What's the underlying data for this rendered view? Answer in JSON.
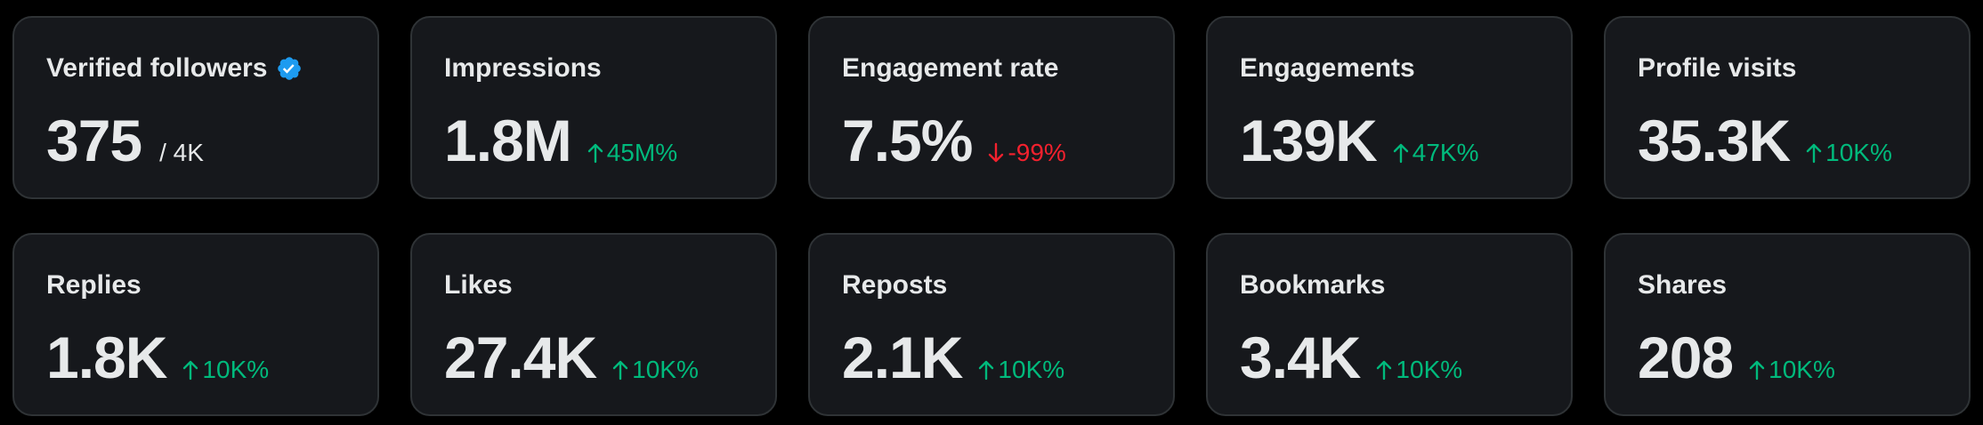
{
  "colors": {
    "background": "#000000",
    "card": "#16181c",
    "card_border": "#2f3336",
    "text": "#e7e9ea",
    "up": "#00ba7c",
    "down": "#f4212e",
    "verified": "#1d9bf0"
  },
  "cards": [
    {
      "label": "Verified followers",
      "value": "375",
      "sub": "/ 4K",
      "icon": "verified-badge-icon"
    },
    {
      "label": "Impressions",
      "value": "1.8M",
      "delta": "45M%",
      "direction": "up"
    },
    {
      "label": "Engagement rate",
      "value": "7.5%",
      "delta": "-99%",
      "direction": "down"
    },
    {
      "label": "Engagements",
      "value": "139K",
      "delta": "47K%",
      "direction": "up"
    },
    {
      "label": "Profile visits",
      "value": "35.3K",
      "delta": "10K%",
      "direction": "up"
    },
    {
      "label": "Replies",
      "value": "1.8K",
      "delta": "10K%",
      "direction": "up"
    },
    {
      "label": "Likes",
      "value": "27.4K",
      "delta": "10K%",
      "direction": "up"
    },
    {
      "label": "Reposts",
      "value": "2.1K",
      "delta": "10K%",
      "direction": "up"
    },
    {
      "label": "Bookmarks",
      "value": "3.4K",
      "delta": "10K%",
      "direction": "up"
    },
    {
      "label": "Shares",
      "value": "208",
      "delta": "10K%",
      "direction": "up"
    }
  ]
}
